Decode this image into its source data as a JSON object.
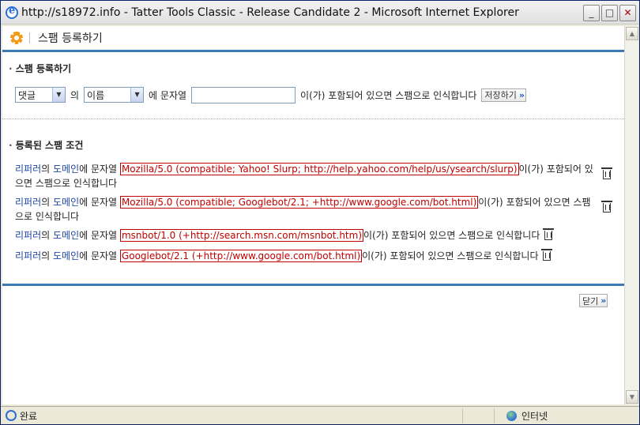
{
  "window": {
    "title": "http://s18972.info - Tatter Tools Classic - Release Candidate 2 - Microsoft Internet Explorer",
    "minimize_label": "_",
    "maximize_label": "□",
    "close_label": "✕"
  },
  "header": {
    "title": "스팸 등록하기"
  },
  "register_section": {
    "title": "스팸 등록하기",
    "target_select": "댓글",
    "particle_of": "의",
    "field_select": "이름",
    "particle_in": "에 문자열",
    "input_value": "",
    "suffix_text": "이(가) 포함되어 있으면 스팸으로 인식합니다",
    "save_label": "저장하기"
  },
  "registered_section": {
    "title": "등록된 스팸 조건",
    "rules": [
      {
        "referrer": "리퍼러",
        "of": "의",
        "domain": "도메인",
        "in_text": "에 문자열",
        "pattern": "Mozilla/5.0 (compatible; Yahoo! Slurp; http://help.yahoo.com/help/us/ysearch/slurp)",
        "suffix": "이(가) 포함되어 있으면 스팸으로 인식합니다"
      },
      {
        "referrer": "리퍼러",
        "of": "의",
        "domain": "도메인",
        "in_text": "에 문자열",
        "pattern": "Mozilla/5.0 (compatible; Googlebot/2.1; +http://www.google.com/bot.html)",
        "suffix": "이(가) 포함되어 있으면 스팸으로 인식합니다"
      },
      {
        "referrer": "리퍼러",
        "of": "의",
        "domain": "도메인",
        "in_text": "에 문자열",
        "pattern": "msnbot/1.0 (+http://search.msn.com/msnbot.htm)",
        "suffix": "이(가) 포함되어 있으면 스팸으로 인식합니다"
      },
      {
        "referrer": "리퍼러",
        "of": "의",
        "domain": "도메인",
        "in_text": "에 문자열",
        "pattern": "Googlebot/2.1 (+http://www.google.com/bot.html)",
        "suffix": "이(가) 포함되어 있으면 스팸으로 인식합니다"
      }
    ]
  },
  "footer": {
    "close_label": "닫기"
  },
  "statusbar": {
    "status_text": "완료",
    "zone_text": "인터넷"
  },
  "colors": {
    "accent_blue": "#3b7ab5",
    "pattern_red": "#c00000",
    "link_blue": "#1d46a6"
  }
}
